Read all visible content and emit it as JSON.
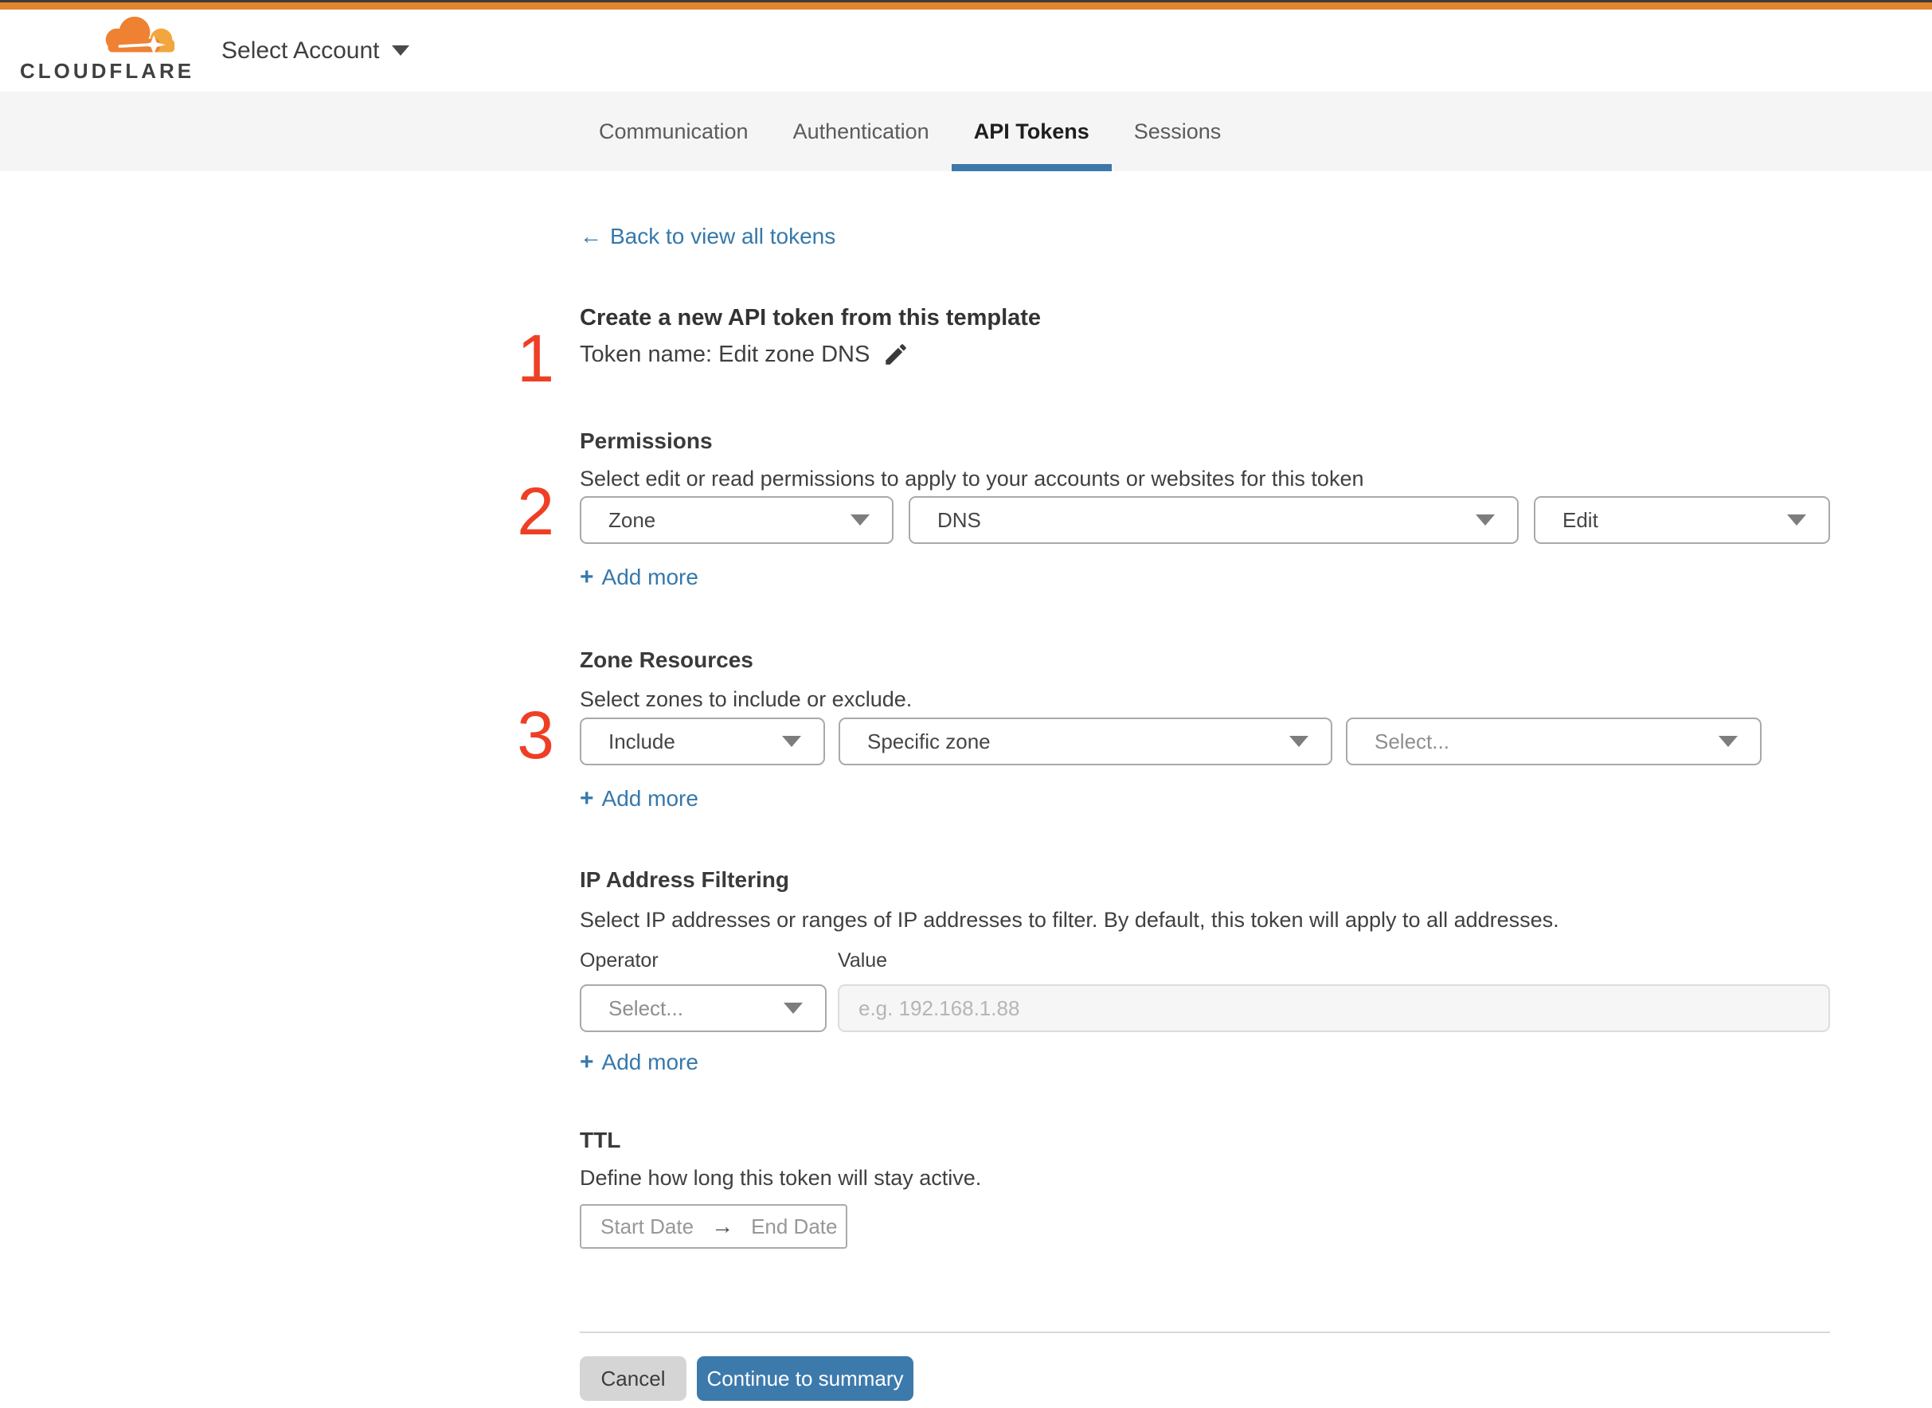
{
  "header": {
    "logo_text": "CLOUDFLARE",
    "account_selector": "Select Account"
  },
  "tabs": [
    {
      "label": "Communication",
      "active": false
    },
    {
      "label": "Authentication",
      "active": false
    },
    {
      "label": "API Tokens",
      "active": true
    },
    {
      "label": "Sessions",
      "active": false
    }
  ],
  "back": {
    "arrow": "←",
    "label": "Back to view all tokens"
  },
  "annotations": {
    "step1": "1",
    "step2": "2",
    "step3": "3"
  },
  "intro": {
    "heading": "Create a new API token from this template",
    "token_line": "Token name: Edit zone DNS"
  },
  "add_more": {
    "plus": "+",
    "label": "Add more"
  },
  "permissions": {
    "heading": "Permissions",
    "description": "Select edit or read permissions to apply to your accounts or websites for this token",
    "scope_value": "Zone",
    "resource_value": "DNS",
    "access_value": "Edit"
  },
  "zone_resources": {
    "heading": "Zone Resources",
    "description": "Select zones to include or exclude.",
    "mode_value": "Include",
    "type_value": "Specific zone",
    "zone_placeholder": "Select..."
  },
  "ip_filtering": {
    "heading": "IP Address Filtering",
    "description": "Select IP addresses or ranges of IP addresses to filter. By default, this token will apply to all addresses.",
    "operator_label": "Operator",
    "value_label": "Value",
    "operator_placeholder": "Select...",
    "value_placeholder": "e.g. 192.168.1.88"
  },
  "ttl": {
    "heading": "TTL",
    "description": "Define how long this token will stay active.",
    "start_placeholder": "Start Date",
    "arrow": "→",
    "end_placeholder": "End Date"
  },
  "footer": {
    "cancel_label": "Cancel",
    "continue_label": "Continue to summary"
  },
  "colors": {
    "brand_orange": "#e0852d",
    "logo_orange": "#ee8132",
    "logo_light_orange": "#f2a63e",
    "link_blue": "#3678ab",
    "button_blue": "#3d7aac",
    "tab_underline_blue": "#3c78a9",
    "annotation_red": "#ee3f25"
  }
}
